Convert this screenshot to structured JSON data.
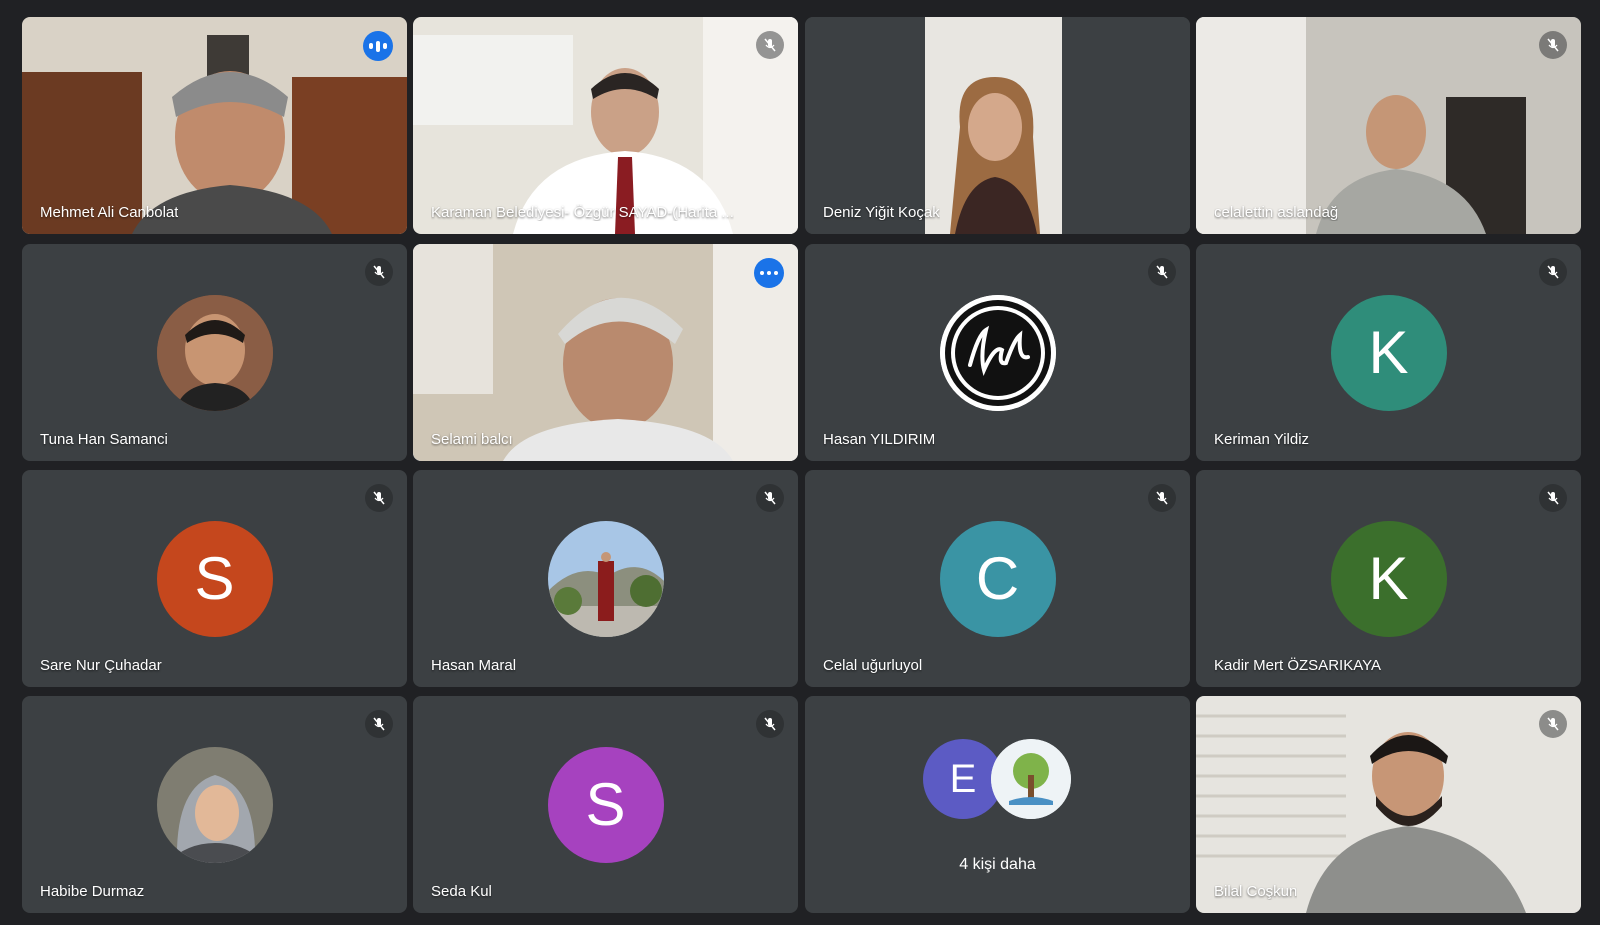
{
  "participants": [
    {
      "name": "Mehmet Ali Canbolat",
      "status": "speaking"
    },
    {
      "name": "Karaman Belediyesi- Özgür SAYAD-(Harita ...",
      "status": "muted"
    },
    {
      "name": "Deniz Yiğit Koçak",
      "status": "none"
    },
    {
      "name": "celalettin aslandağ",
      "status": "muted"
    },
    {
      "name": "Tuna Han Samanci",
      "status": "muted"
    },
    {
      "name": "Selami balcı",
      "status": "more-options"
    },
    {
      "name": "Hasan YILDIRIM",
      "status": "muted"
    },
    {
      "name": "Keriman Yildiz",
      "status": "muted",
      "initial": "K",
      "color": "#2f8d7a"
    },
    {
      "name": "Sare Nur Çuhadar",
      "status": "muted",
      "initial": "S",
      "color": "#c5471d"
    },
    {
      "name": "Hasan Maral",
      "status": "muted"
    },
    {
      "name": "Celal uğurluyol",
      "status": "muted",
      "initial": "C",
      "color": "#3a94a4"
    },
    {
      "name": "Kadir Mert ÖZSARIKAYA",
      "status": "muted",
      "initial": "K",
      "color": "#3b6f2c"
    },
    {
      "name": "Habibe Durmaz",
      "status": "muted"
    },
    {
      "name": "Seda Kul",
      "status": "muted",
      "initial": "S",
      "color": "#a642bf"
    },
    {
      "name": "Bilal Coşkun",
      "status": "muted"
    }
  ],
  "others": {
    "label": "4 kişi daha",
    "avatar_initial": "E",
    "avatar_color": "#5c5bc4"
  },
  "colors": {
    "background": "#202124",
    "tile": "#3c4043",
    "active_border": "#8ab4f8",
    "speaking_badge": "#1a73e8"
  }
}
